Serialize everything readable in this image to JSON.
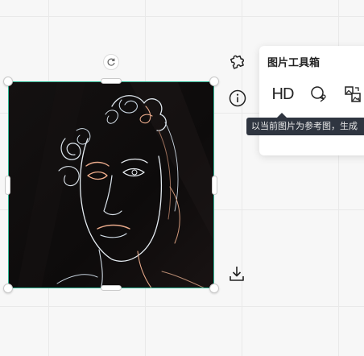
{
  "toolbox": {
    "title": "图片工具箱",
    "hd_label": "HD",
    "tooltip": "以当前图片为参考图，生成"
  },
  "icons": {
    "rotate": "rotate-icon",
    "plugin": "puzzle-icon",
    "info": "info-icon",
    "download": "download-icon",
    "hd": "hd-icon",
    "lasso": "lasso-icon",
    "image_ref": "image-reference-icon"
  },
  "colors": {
    "selection_border": "#31b896",
    "tooltip_bg": "#2f3540",
    "image_bg": "#0e0c0c"
  }
}
